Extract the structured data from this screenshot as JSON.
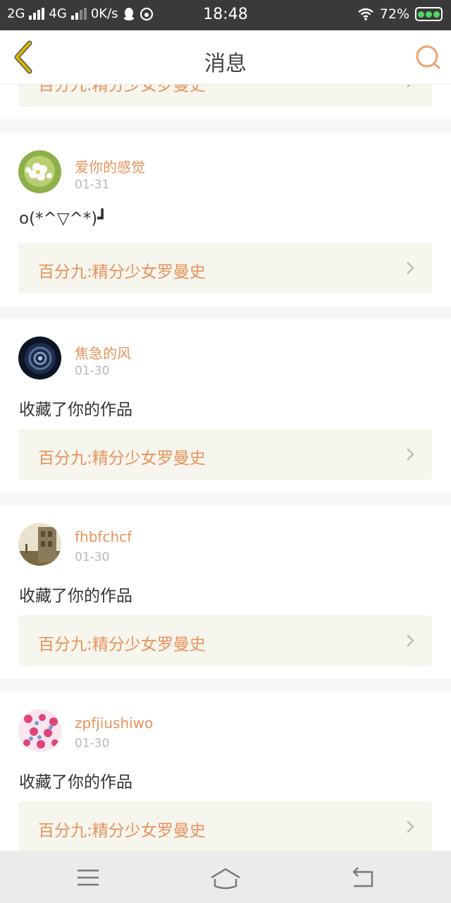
{
  "status_bar": {
    "sim1": "2G",
    "sim2": "4G",
    "speed": "0K/s",
    "time": "18:48",
    "battery": "72%"
  },
  "header": {
    "title": "消息",
    "back_icon": "chevron-left-icon",
    "search_icon": "search-icon"
  },
  "colors": {
    "accent": "#e8935b",
    "back_icon": "#d9b600",
    "link_bg": "#f6f5ee"
  },
  "messages": [
    {
      "username": "",
      "date": "",
      "text": "",
      "work_title": "百分九:精分少女罗曼史"
    },
    {
      "username": "爱你的感觉",
      "date": "01-31",
      "text": "o(*^▽^*)┛",
      "work_title": "百分九:精分少女罗曼史",
      "avatar": "white-flowers"
    },
    {
      "username": "焦急的风",
      "date": "01-30",
      "text": "收藏了你的作品",
      "work_title": "百分九:精分少女罗曼史",
      "avatar": "dark-rose"
    },
    {
      "username": "fhbfchcf",
      "date": "01-30",
      "text": "收藏了你的作品",
      "work_title": "百分九:精分少女罗曼史",
      "avatar": "building-photo"
    },
    {
      "username": "zpfjiushiwo",
      "date": "01-30",
      "text": "收藏了你的作品",
      "work_title": "百分九:精分少女罗曼史",
      "avatar": "pink-pattern"
    }
  ],
  "nav": {
    "menu_icon": "menu-icon",
    "home_icon": "home-icon",
    "back_icon": "back-arrow-icon"
  }
}
